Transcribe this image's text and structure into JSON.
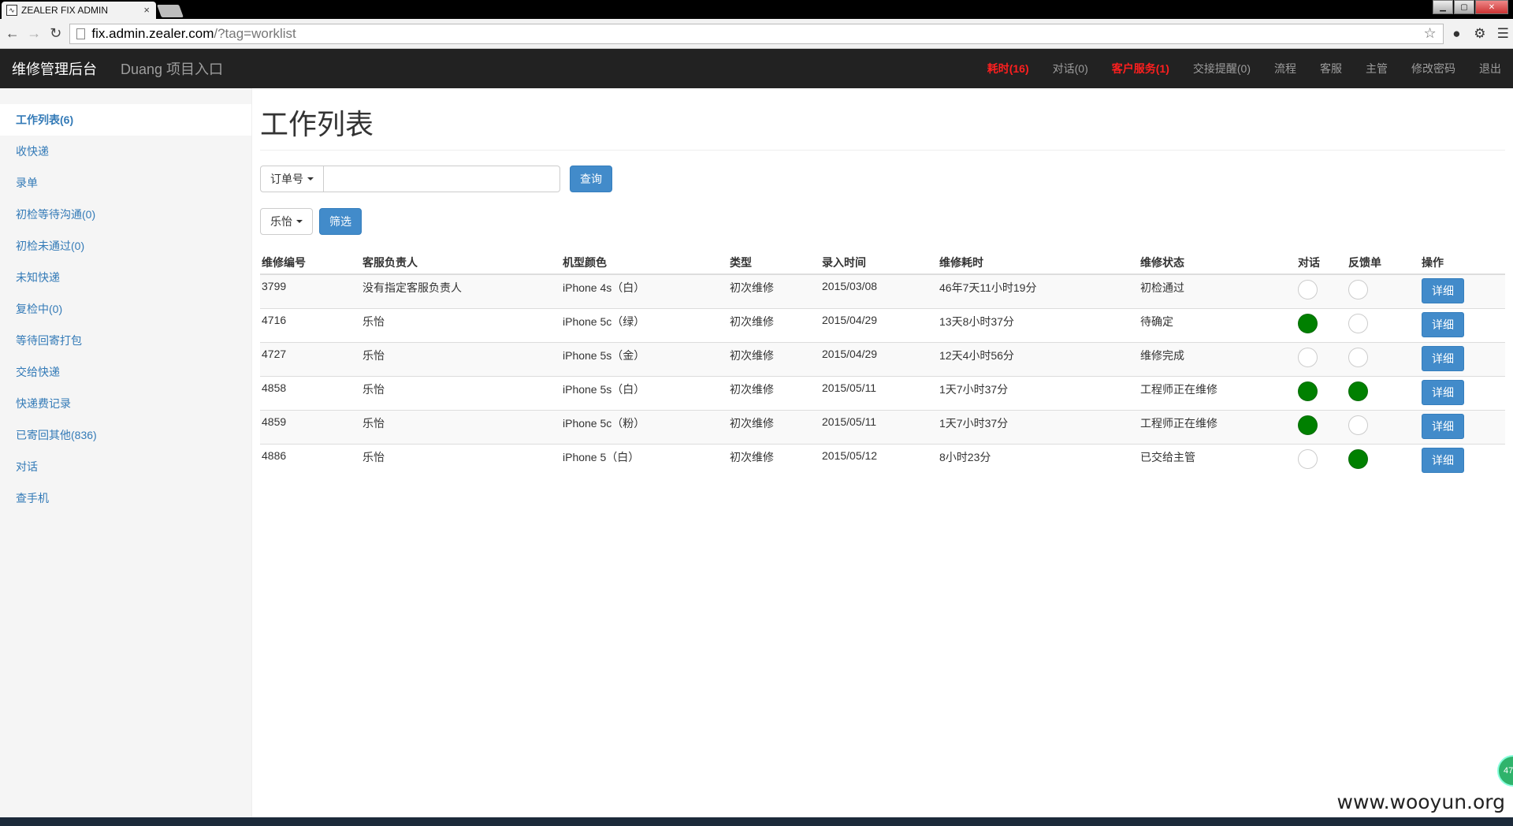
{
  "browser": {
    "tab_title": "ZEALER FIX ADMIN",
    "tab_close": "×",
    "url_host": "fix.admin.zealer.com",
    "url_path": "/?tag=worklist"
  },
  "navbar": {
    "brand": "维修管理后台",
    "project_link": "Duang 项目入口",
    "links": {
      "timeout": "耗时(16)",
      "dialog": "对话(0)",
      "customer_service": "客户服务(1)",
      "handover": "交接提醒(0)",
      "process": "流程",
      "support": "客服",
      "manager": "主管",
      "change_password": "修改密码",
      "logout": "退出"
    }
  },
  "sidebar": {
    "items": [
      {
        "label": "工作列表(6)"
      },
      {
        "label": "收快递"
      },
      {
        "label": "录单"
      },
      {
        "label": "初检等待沟通(0)"
      },
      {
        "label": "初检未通过(0)"
      },
      {
        "label": "未知快递"
      },
      {
        "label": "复检中(0)"
      },
      {
        "label": "等待回寄打包"
      },
      {
        "label": "交给快递"
      },
      {
        "label": "快递费记录"
      },
      {
        "label": "已寄回其他(836)"
      },
      {
        "label": "对话"
      },
      {
        "label": "查手机"
      }
    ]
  },
  "main": {
    "title": "工作列表",
    "search": {
      "field_label": "订单号",
      "value": "",
      "button": "查询"
    },
    "filter": {
      "selected": "乐怡",
      "button": "筛选"
    },
    "table": {
      "headers": [
        "维修编号",
        "客服负责人",
        "机型颜色",
        "类型",
        "录入时间",
        "维修耗时",
        "维修状态",
        "对话",
        "反馈单",
        "操作"
      ],
      "detail_label": "详细",
      "rows": [
        {
          "id": "3799",
          "owner": "没有指定客服负责人",
          "model": "iPhone 4s（白）",
          "type": "初次维修",
          "date": "2015/03/08",
          "duration": "46年7天11小时19分",
          "status": "初检通过",
          "dialog": false,
          "feedback": false
        },
        {
          "id": "4716",
          "owner": "乐怡",
          "model": "iPhone 5c（绿）",
          "type": "初次维修",
          "date": "2015/04/29",
          "duration": "13天8小时37分",
          "status": "待确定",
          "dialog": true,
          "feedback": false
        },
        {
          "id": "4727",
          "owner": "乐怡",
          "model": "iPhone 5s（金）",
          "type": "初次维修",
          "date": "2015/04/29",
          "duration": "12天4小时56分",
          "status": "维修完成",
          "dialog": false,
          "feedback": false
        },
        {
          "id": "4858",
          "owner": "乐怡",
          "model": "iPhone 5s（白）",
          "type": "初次维修",
          "date": "2015/05/11",
          "duration": "1天7小时37分",
          "status": "工程师正在维修",
          "dialog": true,
          "feedback": true
        },
        {
          "id": "4859",
          "owner": "乐怡",
          "model": "iPhone 5c（粉）",
          "type": "初次维修",
          "date": "2015/05/11",
          "duration": "1天7小时37分",
          "status": "工程师正在维修",
          "dialog": true,
          "feedback": false
        },
        {
          "id": "4886",
          "owner": "乐怡",
          "model": "iPhone 5（白）",
          "type": "初次维修",
          "date": "2015/05/12",
          "duration": "8小时23分",
          "status": "已交给主管",
          "dialog": false,
          "feedback": true
        }
      ]
    }
  },
  "watermark": "www.wooyun.org",
  "badge": "47",
  "colors": {
    "accent": "#428bca",
    "navbar": "#222222",
    "alert": "#ff1f1f",
    "status_green": "#008000"
  }
}
